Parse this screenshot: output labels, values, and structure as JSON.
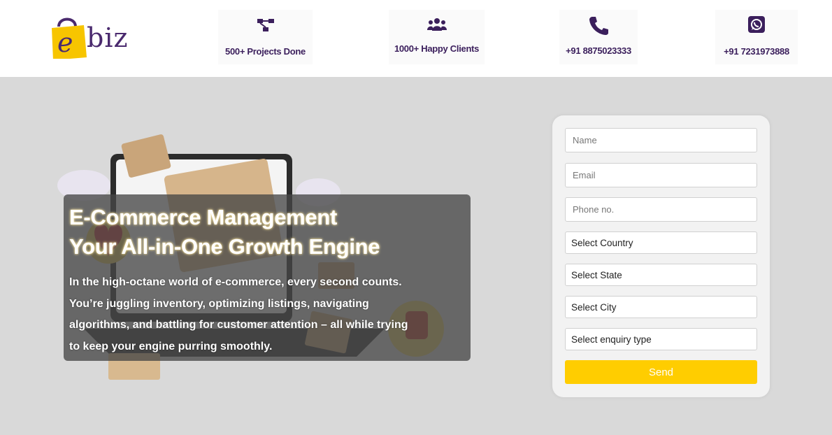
{
  "brand": {
    "logo_text": "biz",
    "logo_letter": "e"
  },
  "stats": [
    {
      "icon": "sitemap-icon",
      "label": "500+ Projects Done"
    },
    {
      "icon": "users-icon",
      "label": "1000+ Happy Clients"
    },
    {
      "icon": "phone-icon",
      "label": "+91 8875023333"
    },
    {
      "icon": "whatsapp-icon",
      "label": "+91 7231973888"
    }
  ],
  "hero": {
    "title_line1": "E-Commerce Management",
    "title_line2": "Your All-in-One Growth Engine",
    "text_lines": [
      "In the high-octane world of e-commerce, every second counts.",
      "You’re juggling inventory, optimizing listings, navigating",
      "algorithms, and battling for customer attention – all while trying",
      "to keep your engine purring smoothly."
    ]
  },
  "form": {
    "name_placeholder": "Name",
    "email_placeholder": "Email",
    "phone_placeholder": "Phone no.",
    "country_select": "Select Country",
    "state_select": "Select State",
    "city_select": "Select City",
    "enquiry_select": "Select enquiry type",
    "send_label": "Send"
  },
  "colors": {
    "brand_purple": "#3b1f5c",
    "accent_yellow": "#ffcd00",
    "background": "#d9d9d9"
  }
}
